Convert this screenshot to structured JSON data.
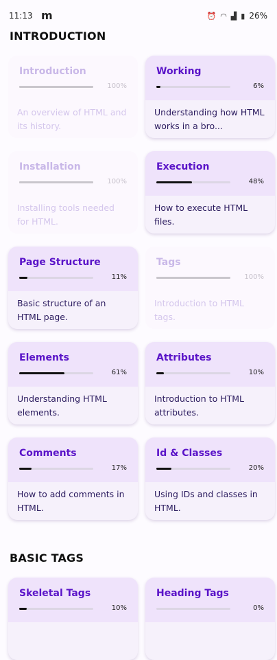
{
  "status": {
    "time": "11:13",
    "app_icon": "m",
    "battery": "26%"
  },
  "sections": [
    {
      "title": "INTRODUCTION",
      "cards": [
        {
          "title": "Introduction",
          "progress": 100,
          "pct_label": "100%",
          "desc": "An overview of HTML and its history.",
          "state": "done"
        },
        {
          "title": "Working",
          "progress": 6,
          "pct_label": "6%",
          "desc": "Understanding how HTML works in a bro...",
          "state": "active"
        },
        {
          "title": "Installation",
          "progress": 100,
          "pct_label": "100%",
          "desc": "Installing tools needed for HTML.",
          "state": "done"
        },
        {
          "title": "Execution",
          "progress": 48,
          "pct_label": "48%",
          "desc": "How to execute HTML files.",
          "state": "active"
        },
        {
          "title": "Page Structure",
          "progress": 11,
          "pct_label": "11%",
          "desc": "Basic structure of an HTML page.",
          "state": "active"
        },
        {
          "title": "Tags",
          "progress": 100,
          "pct_label": "100%",
          "desc": "Introduction to HTML tags.",
          "state": "done"
        },
        {
          "title": "Elements",
          "progress": 61,
          "pct_label": "61%",
          "desc": "Understanding HTML elements.",
          "state": "active"
        },
        {
          "title": "Attributes",
          "progress": 10,
          "pct_label": "10%",
          "desc": "Introduction to HTML attributes.",
          "state": "active"
        },
        {
          "title": "Comments",
          "progress": 17,
          "pct_label": "17%",
          "desc": "How to add comments in HTML.",
          "state": "active"
        },
        {
          "title": "Id & Classes",
          "progress": 20,
          "pct_label": "20%",
          "desc": "Using IDs and classes in HTML.",
          "state": "active"
        }
      ]
    },
    {
      "title": "BASIC TAGS",
      "cards": [
        {
          "title": "Skeletal Tags",
          "progress": 10,
          "pct_label": "10%",
          "desc": "",
          "state": "active"
        },
        {
          "title": "Heading Tags",
          "progress": 0,
          "pct_label": "0%",
          "desc": "",
          "state": "active"
        }
      ]
    }
  ]
}
